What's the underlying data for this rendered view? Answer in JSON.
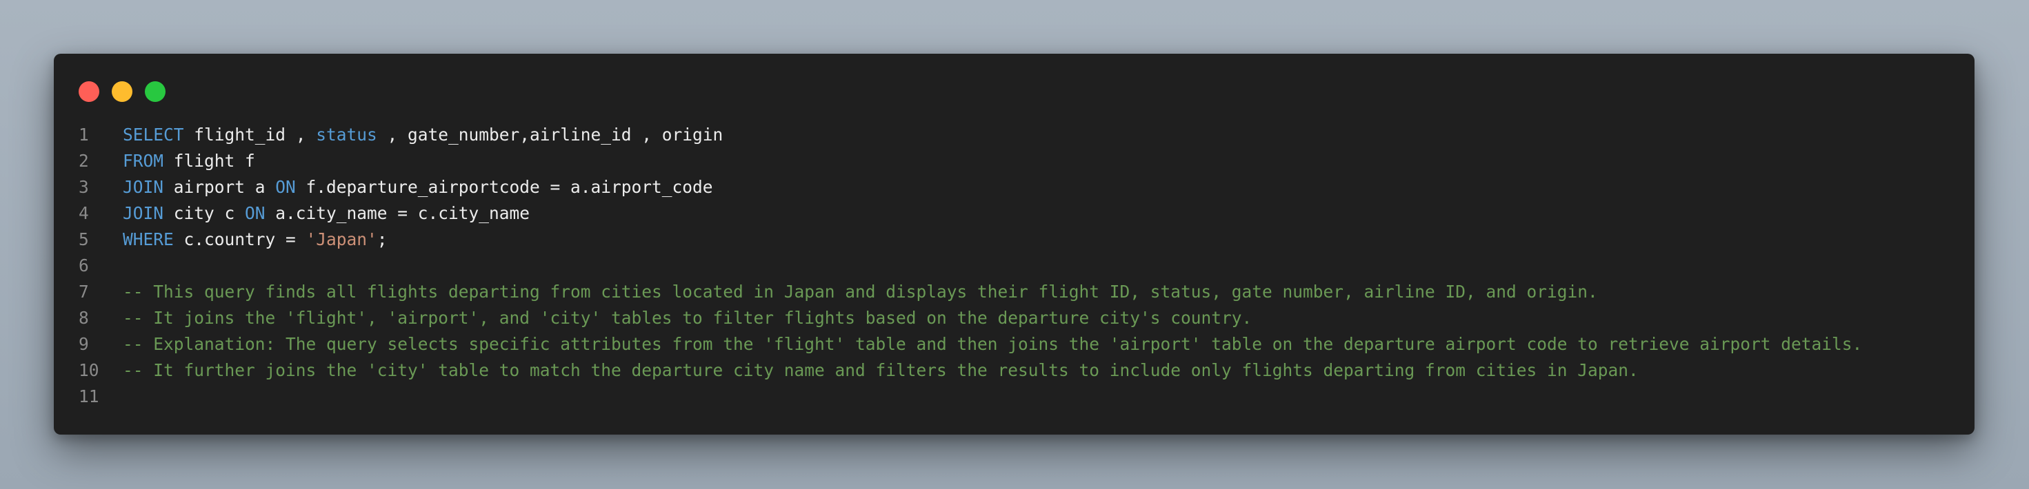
{
  "window": {
    "traffic_lights": [
      "close",
      "minimize",
      "maximize"
    ]
  },
  "colors": {
    "keyword": "#569cd6",
    "string": "#ce9178",
    "comment": "#6a9955",
    "text": "#ececec",
    "line_number": "#8a8a8a",
    "background": "#1f1f1f"
  },
  "code": {
    "lines": [
      {
        "number": "1",
        "tokens": [
          {
            "type": "kw",
            "text": "SELECT"
          },
          {
            "type": "src",
            "text": " flight_id , "
          },
          {
            "type": "kw",
            "text": "status"
          },
          {
            "type": "src",
            "text": " , gate_number,airline_id , origin"
          }
        ]
      },
      {
        "number": "2",
        "tokens": [
          {
            "type": "kw",
            "text": "FROM"
          },
          {
            "type": "src",
            "text": " flight f"
          }
        ]
      },
      {
        "number": "3",
        "tokens": [
          {
            "type": "kw",
            "text": "JOIN"
          },
          {
            "type": "src",
            "text": " airport a "
          },
          {
            "type": "kw",
            "text": "ON"
          },
          {
            "type": "src",
            "text": " f.departure_airportcode = a.airport_code"
          }
        ]
      },
      {
        "number": "4",
        "tokens": [
          {
            "type": "kw",
            "text": "JOIN"
          },
          {
            "type": "src",
            "text": " city c "
          },
          {
            "type": "kw",
            "text": "ON"
          },
          {
            "type": "src",
            "text": " a.city_name = c.city_name"
          }
        ]
      },
      {
        "number": "5",
        "tokens": [
          {
            "type": "kw",
            "text": "WHERE"
          },
          {
            "type": "src",
            "text": " c.country = "
          },
          {
            "type": "str",
            "text": "'Japan'"
          },
          {
            "type": "src",
            "text": ";"
          }
        ]
      },
      {
        "number": "6",
        "tokens": []
      },
      {
        "number": "7",
        "tokens": [
          {
            "type": "cm",
            "text": "-- This query finds all flights departing from cities located in Japan and displays their flight ID, status, gate number, airline ID, and origin."
          }
        ]
      },
      {
        "number": "8",
        "tokens": [
          {
            "type": "cm",
            "text": "-- It joins the 'flight', 'airport', and 'city' tables to filter flights based on the departure city's country."
          }
        ]
      },
      {
        "number": "9",
        "tokens": [
          {
            "type": "cm",
            "text": "-- Explanation: The query selects specific attributes from the 'flight' table and then joins the 'airport' table on the departure airport code to retrieve airport details."
          }
        ]
      },
      {
        "number": "10",
        "tokens": [
          {
            "type": "cm",
            "text": "-- It further joins the 'city' table to match the departure city name and filters the results to include only flights departing from cities in Japan."
          }
        ]
      },
      {
        "number": "11",
        "tokens": []
      }
    ]
  }
}
